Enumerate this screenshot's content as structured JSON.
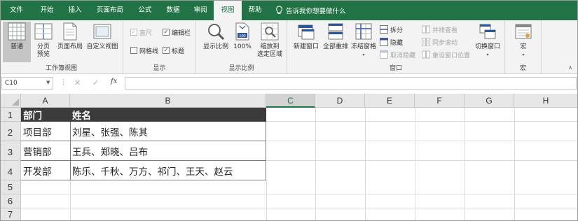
{
  "tabs": [
    {
      "label": "文件",
      "name": "tab-file"
    },
    {
      "label": "开始",
      "name": "tab-home"
    },
    {
      "label": "插入",
      "name": "tab-insert"
    },
    {
      "label": "页面布局",
      "name": "tab-page-layout"
    },
    {
      "label": "公式",
      "name": "tab-formulas"
    },
    {
      "label": "数据",
      "name": "tab-data"
    },
    {
      "label": "审阅",
      "name": "tab-review"
    },
    {
      "label": "视图",
      "name": "tab-view"
    },
    {
      "label": "帮助",
      "name": "tab-help"
    }
  ],
  "active_tab": "视图",
  "tell_me": "告诉我你想要做什么",
  "ribbon": {
    "workbook_views": {
      "label": "工作簿视图",
      "normal": "普通",
      "page_break_1": "分页",
      "page_break_2": "预览",
      "page_layout": "页面布局",
      "custom_views": "自定义视图"
    },
    "show": {
      "label": "显示",
      "ruler": "直尺",
      "formula_bar": "编辑栏",
      "gridlines": "网格线",
      "headings": "标题"
    },
    "zoom": {
      "label": "显示比例",
      "zoom": "显示比例",
      "hundred": "100%",
      "zoom_sel_1": "缩放到",
      "zoom_sel_2": "选定区域"
    },
    "window": {
      "label": "窗口",
      "new_window": "新建窗口",
      "arrange_all": "全部重排",
      "freeze_panes": "冻结窗格",
      "split": "拆分",
      "hide": "隐藏",
      "unhide": "取消隐藏",
      "side_by_side": "并排查看",
      "sync_scroll": "同步滚动",
      "reset_position": "重设窗口位置",
      "switch_windows": "切换窗口"
    },
    "macros": {
      "label": "宏",
      "macros": "宏"
    }
  },
  "formula_bar": {
    "name_box": "C10",
    "fx": "fx",
    "cancel": "✕",
    "enter": "✓",
    "content": ""
  },
  "columns": [
    "A",
    "B",
    "C",
    "D",
    "E",
    "F",
    "G",
    "H"
  ],
  "selected_column": "C",
  "rows": [
    "1",
    "2",
    "3",
    "4",
    "5",
    "6",
    "7"
  ],
  "table": {
    "header": [
      "部门",
      "姓名"
    ],
    "data": [
      [
        "项目部",
        "刘星、张强、陈其"
      ],
      [
        "营销部",
        "王兵、郑晓、吕布"
      ],
      [
        "开发部",
        "陈乐、千秋、万方、祁门、王天、赵云"
      ]
    ]
  },
  "colors": {
    "brand": "#217346",
    "header_fill": "#3b3b3b"
  }
}
